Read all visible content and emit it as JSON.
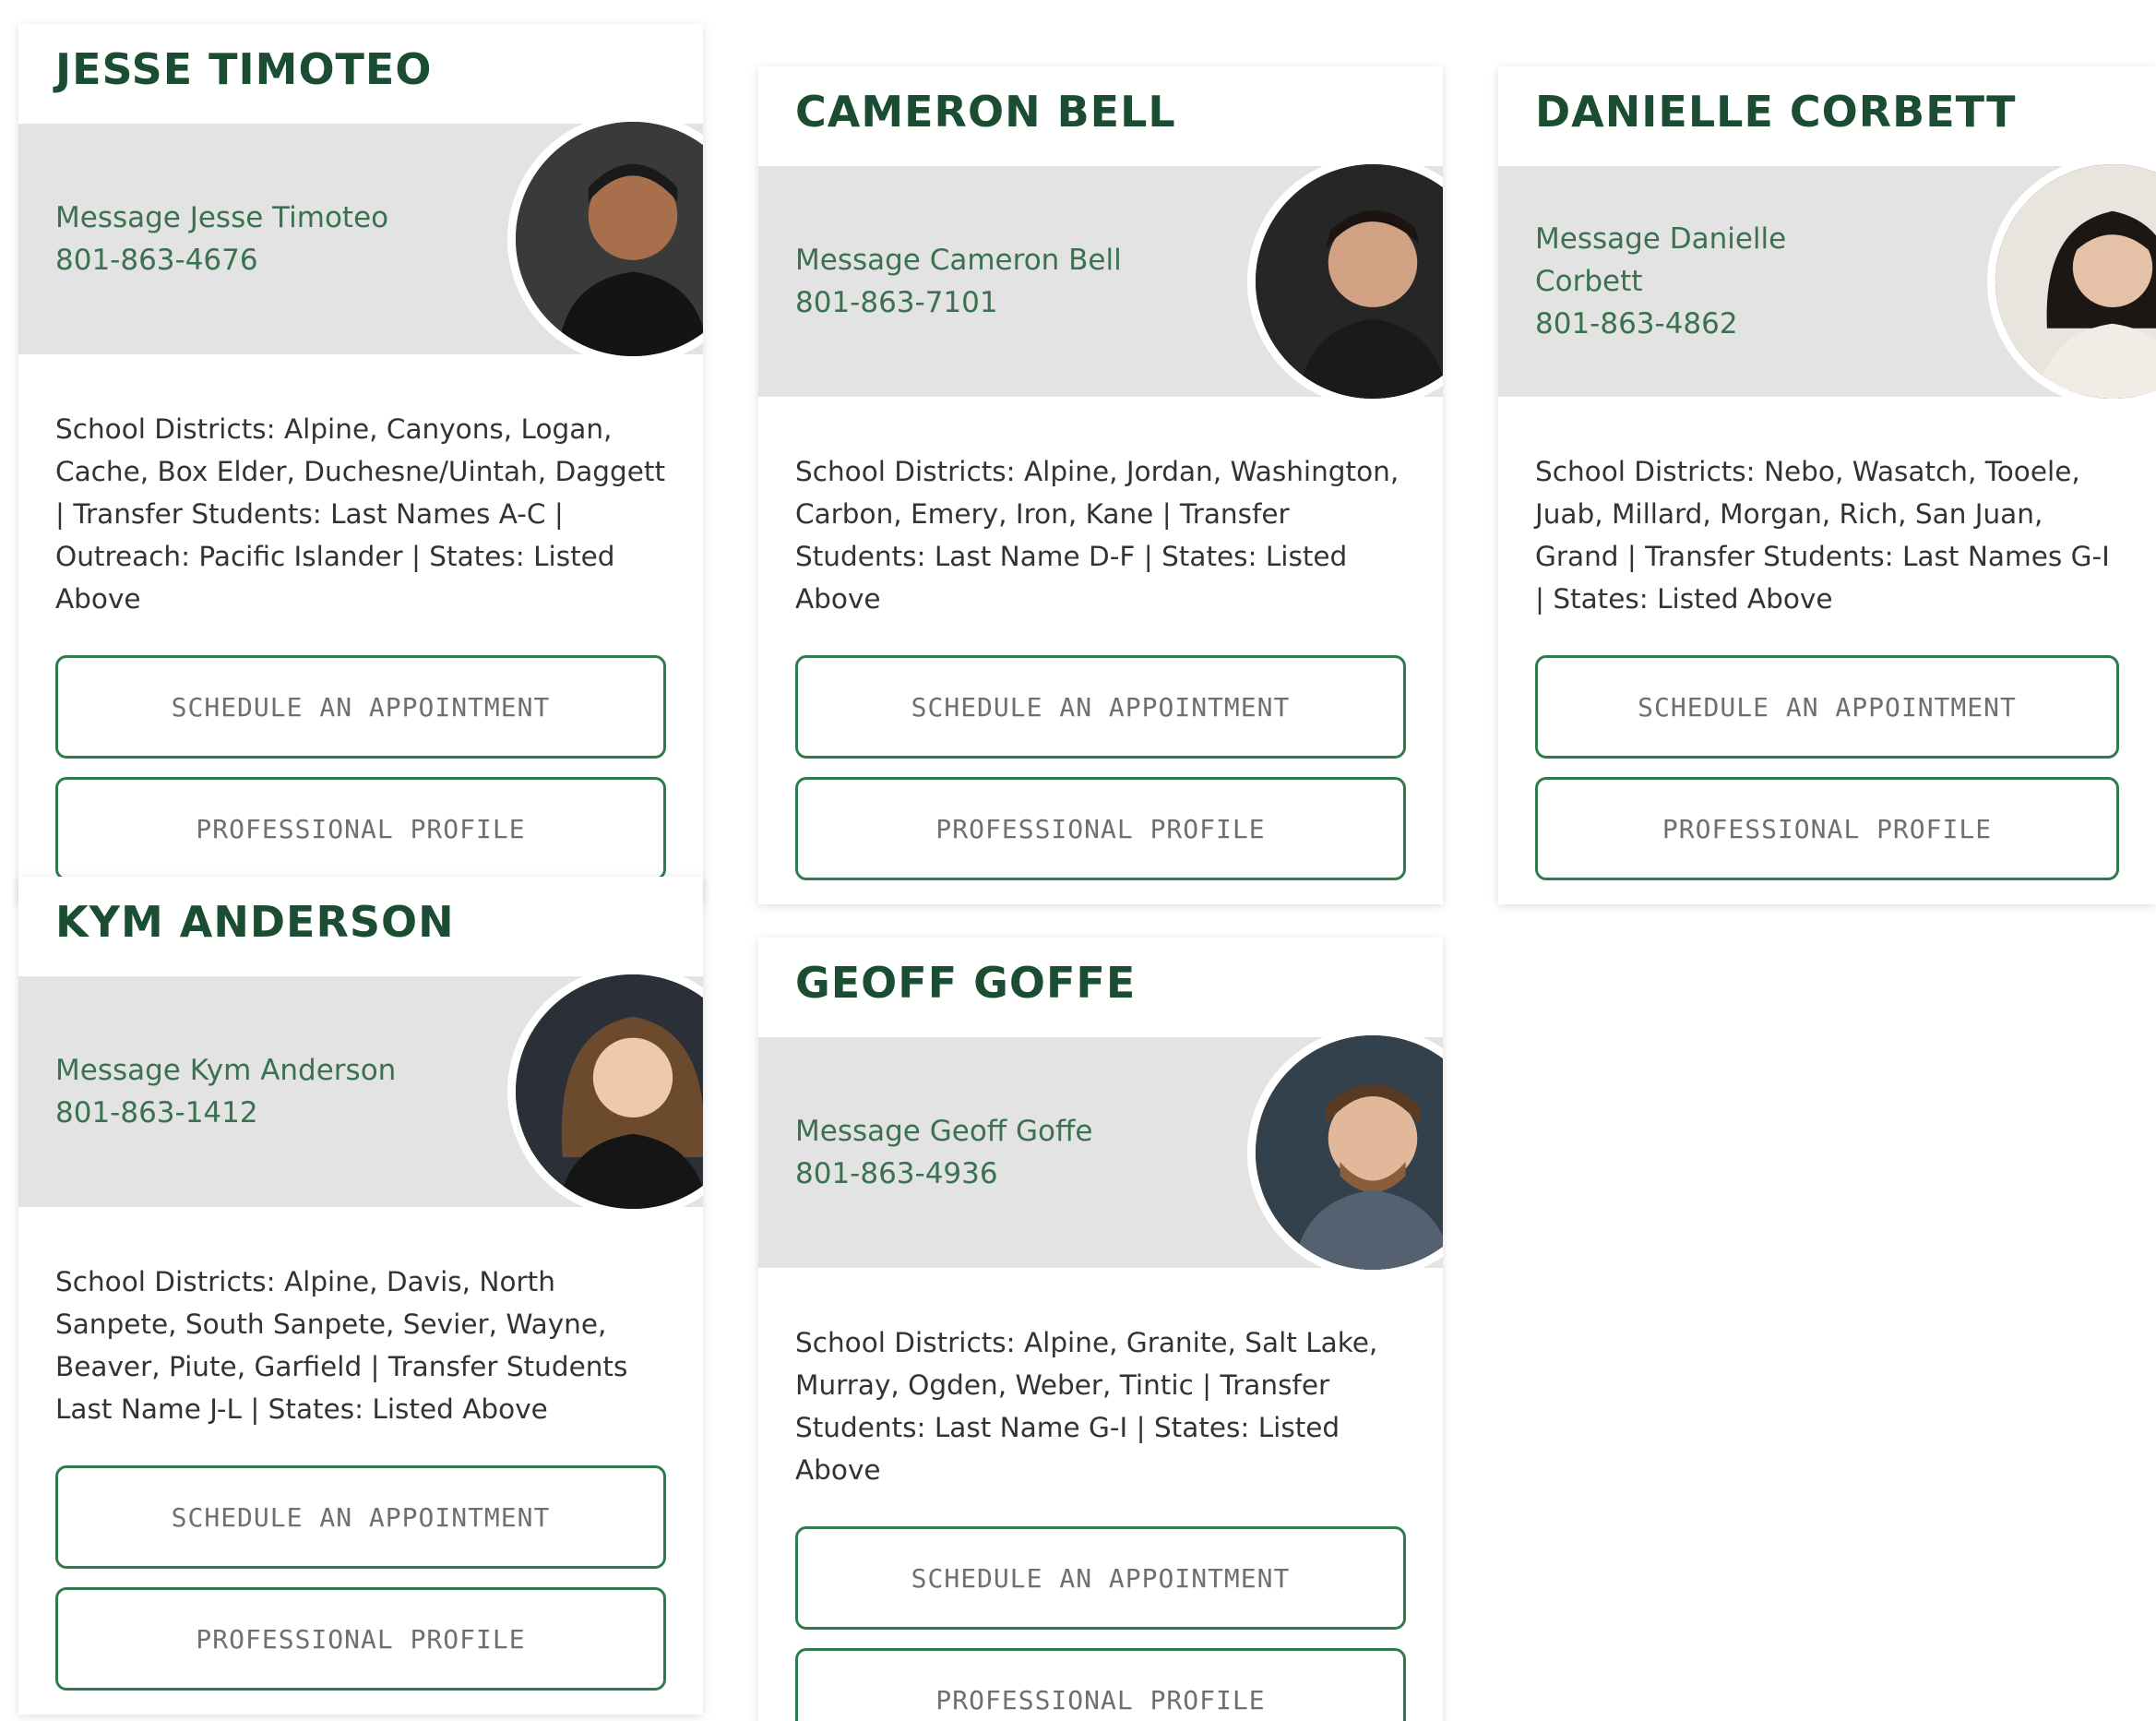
{
  "advisors": [
    {
      "name": "JESSE TIMOTEO",
      "message_link": "Message Jesse Timoteo",
      "phone": "801-863-4676",
      "districts": "School Districts: Alpine, Canyons, Logan, Cache, Box Elder, Duchesne/Uintah, Daggett | Transfer Students: Last Names A-C | Outreach: Pacific Islander | States: Listed Above",
      "schedule_label": "SCHEDULE AN APPOINTMENT",
      "profile_label": "PROFESSIONAL PROFILE"
    },
    {
      "name": "CAMERON BELL",
      "message_link": "Message Cameron Bell",
      "phone": "801-863-7101",
      "districts": "School Districts: Alpine, Jordan, Washington, Carbon, Emery, Iron, Kane | Transfer Students: Last Name D-F | States: Listed Above",
      "schedule_label": "SCHEDULE AN APPOINTMENT",
      "profile_label": "PROFESSIONAL PROFILE"
    },
    {
      "name": "DANIELLE CORBETT",
      "message_link": "Message Danielle Corbett",
      "phone": "801-863-4862",
      "districts": "School Districts: Nebo, Wasatch, Tooele, Juab, Millard, Morgan, Rich, San Juan, Grand | Transfer Students: Last Names G-I | States: Listed Above",
      "schedule_label": "SCHEDULE AN APPOINTMENT",
      "profile_label": "PROFESSIONAL PROFILE"
    },
    {
      "name": "KYM ANDERSON",
      "message_link": "Message Kym Anderson",
      "phone": "801-863-1412",
      "districts": "School Districts: Alpine, Davis, North Sanpete, South Sanpete, Sevier, Wayne, Beaver, Piute, Garfield | Transfer Students Last Name J-L | States: Listed Above",
      "schedule_label": "SCHEDULE AN APPOINTMENT",
      "profile_label": "PROFESSIONAL PROFILE"
    },
    {
      "name": "GEOFF GOFFE",
      "message_link": "Message Geoff Goffe",
      "phone": "801-863-4936",
      "districts": "School Districts: Alpine, Granite, Salt Lake, Murray, Ogden, Weber, Tintic | Transfer Students: Last Name G-I | States: Listed Above",
      "schedule_label": "SCHEDULE AN APPOINTMENT",
      "profile_label": "PROFESSIONAL PROFILE"
    }
  ],
  "colors": {
    "name_green": "#1b4d32",
    "link_green": "#3a7250",
    "button_border": "#2f7a4e",
    "band_gray": "#e3e3e3"
  },
  "icons": {
    "avatar": "person-photo-avatar"
  }
}
